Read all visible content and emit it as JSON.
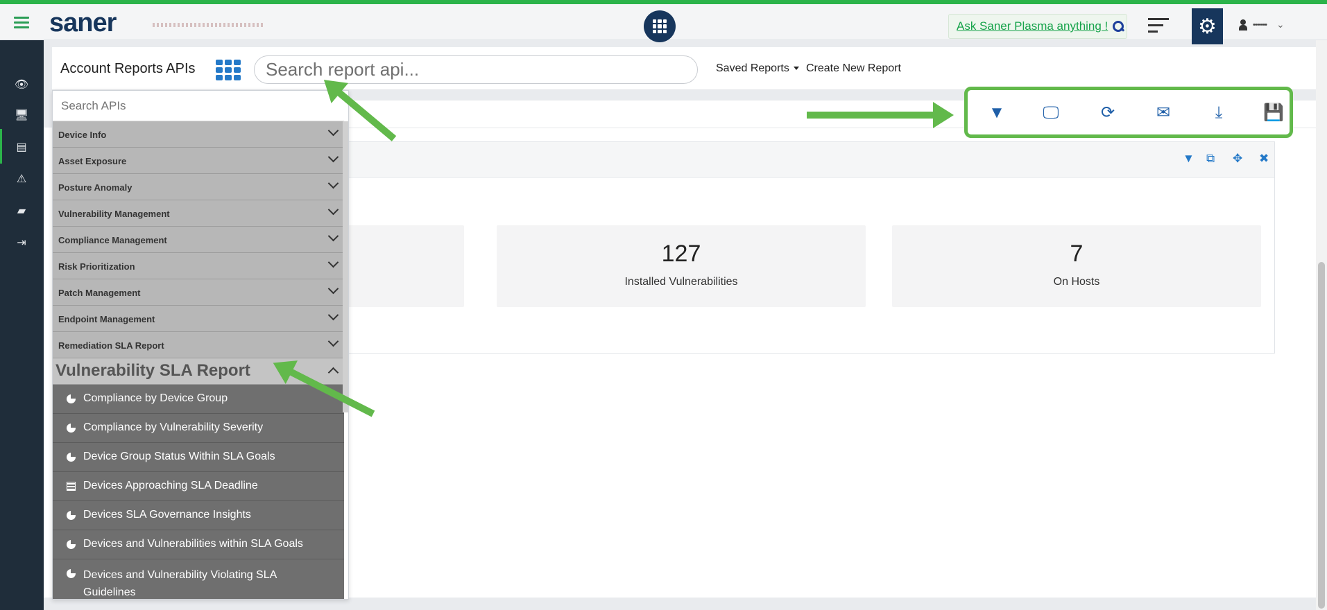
{
  "app": {
    "logo": "saner"
  },
  "topbar": {
    "ask_label": "Ask Saner Plasma anything !",
    "user_name": "•••••••"
  },
  "header": {
    "title": "Account Reports APIs",
    "search_placeholder": "Search report api...",
    "saved_reports": "Saved Reports",
    "create_new": "Create New Report"
  },
  "api_panel": {
    "search_placeholder": "Search APIs",
    "categories": [
      "Device Info",
      "Asset Exposure",
      "Posture Anomaly",
      "Vulnerability Management",
      "Compliance Management",
      "Risk Prioritization",
      "Patch Management",
      "Endpoint Management",
      "Remediation SLA Report"
    ],
    "open_category": "Vulnerability SLA Report",
    "items": [
      "Compliance by Device Group",
      "Compliance by Vulnerability Severity",
      "Device Group Status Within SLA Goals",
      "Devices Approaching SLA Deadline",
      "Devices SLA Governance Insights",
      "Devices and Vulnerabilities within SLA Goals",
      "Devices and Vulnerability Violating SLA Guidelines"
    ]
  },
  "cards": [
    {
      "value": "127",
      "label": "Installed Vulnerabilities"
    },
    {
      "value": "7",
      "label": "On Hosts"
    }
  ],
  "toolbar_icons": [
    "filter-icon",
    "monitor-remove-icon",
    "refresh-icon",
    "mail-icon",
    "download-icon",
    "save-icon"
  ],
  "colors": {
    "accent": "#2bb34a",
    "navy": "#17365c",
    "icon_blue": "#1f5fa8",
    "annotation_green": "#62b94b"
  }
}
